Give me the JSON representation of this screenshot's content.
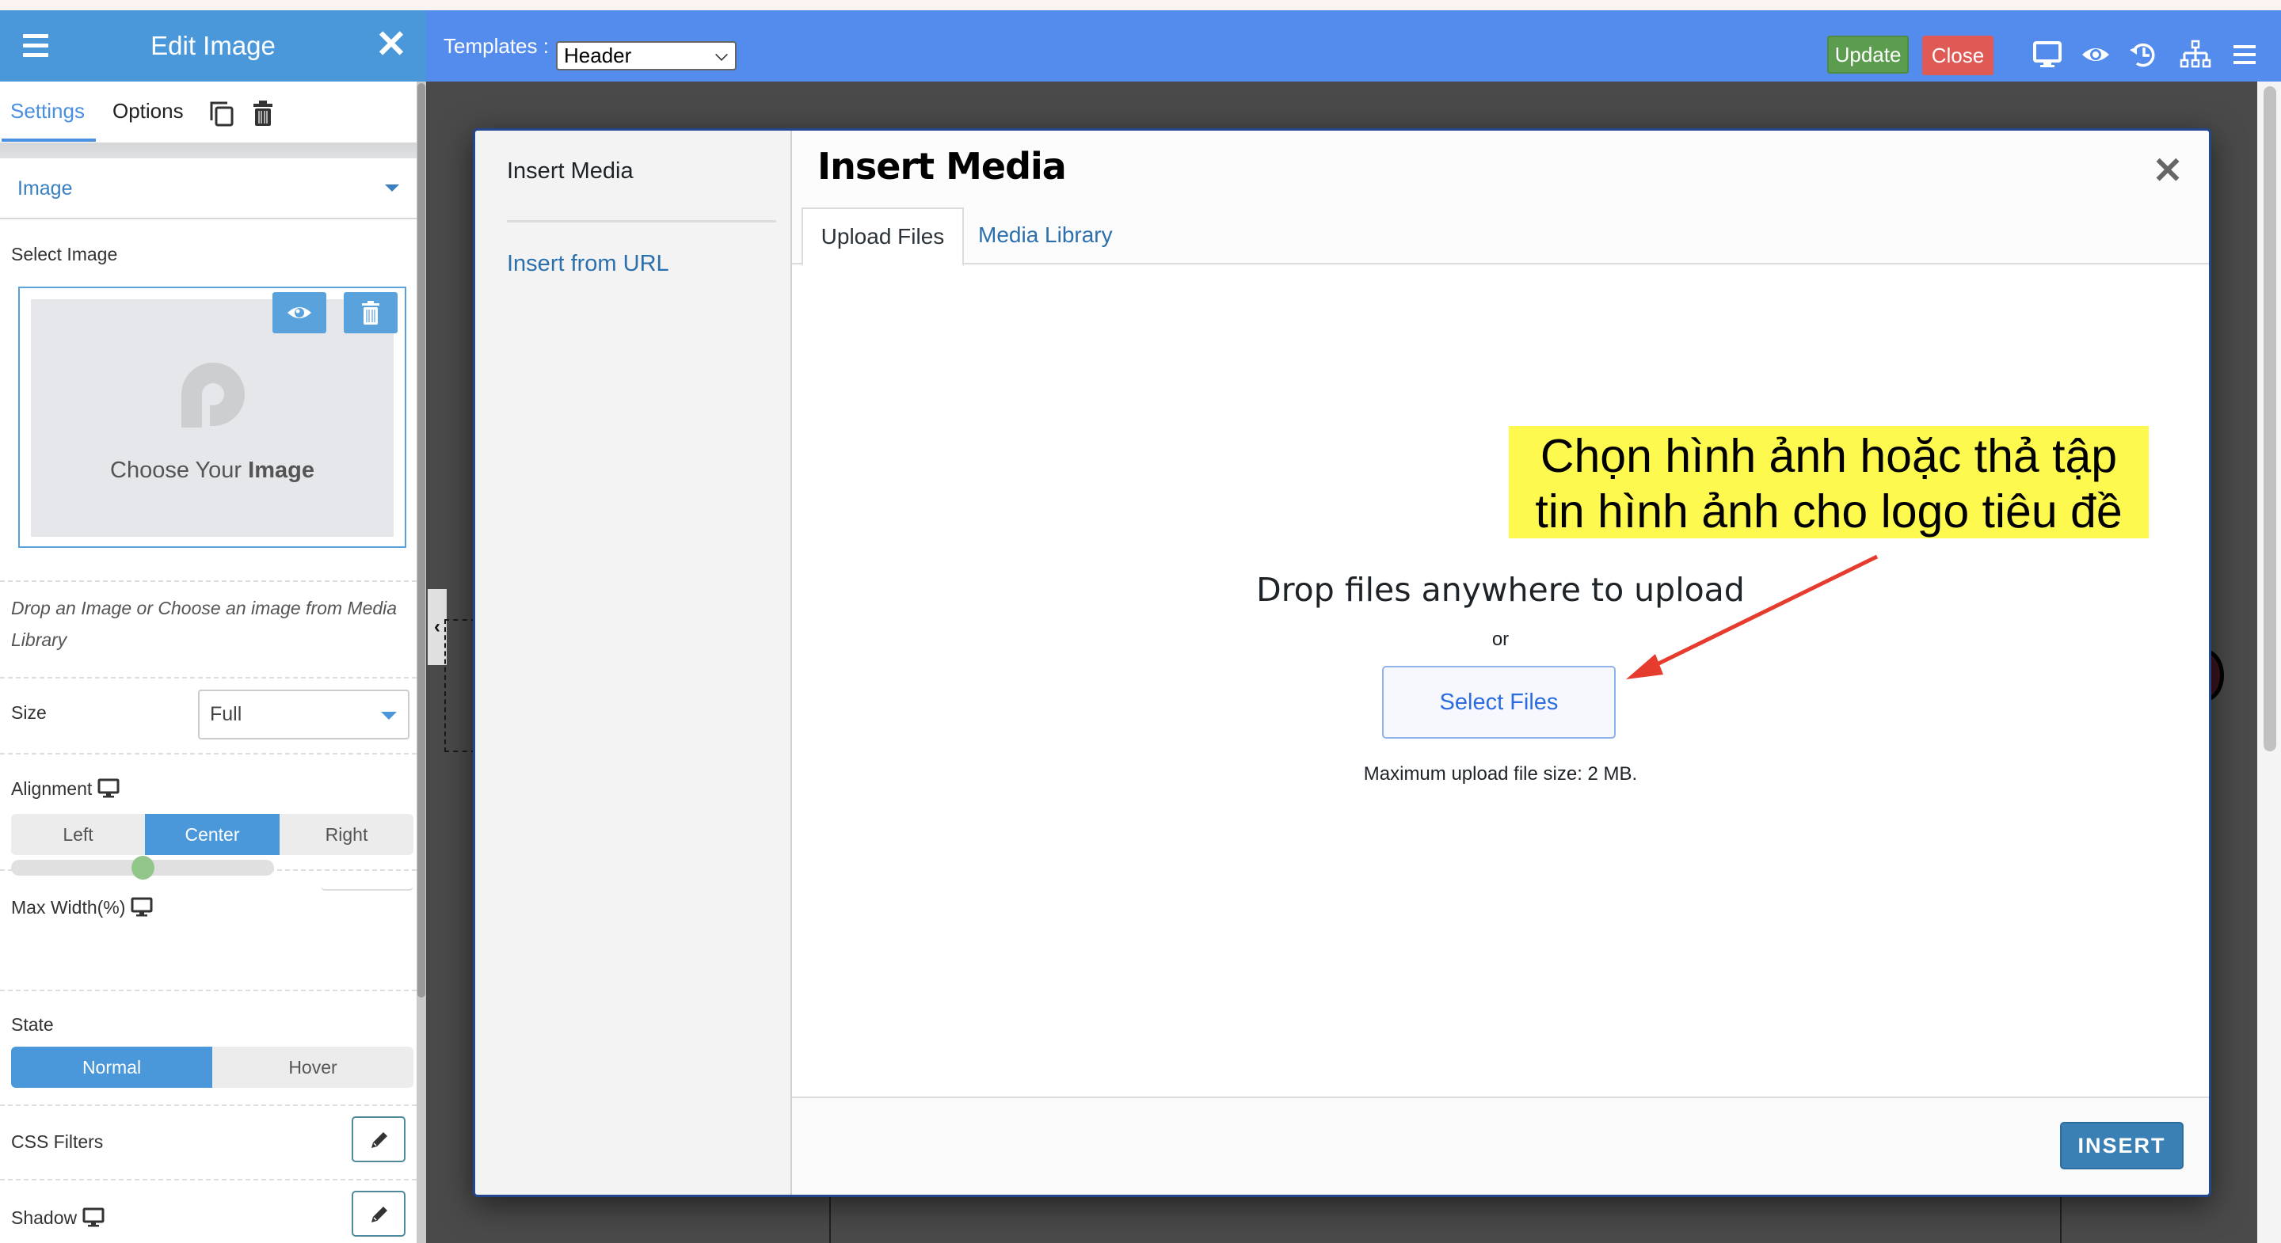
{
  "header": {
    "panel_title": "Edit Image",
    "templates_label": "Templates :",
    "templates_value": "Header",
    "update_label": "Update",
    "close_label": "Close",
    "icons": [
      "desktop-icon",
      "preview-eye-icon",
      "history-icon",
      "sitemap-icon",
      "menu-icon"
    ]
  },
  "panel": {
    "tabs": [
      {
        "label": "Settings",
        "active": true
      },
      {
        "label": "Options",
        "active": false
      }
    ],
    "section_title": "Image",
    "select_image_label": "Select Image",
    "choose_text_prefix": "Choose  Your",
    "choose_text_bold": "Image",
    "hint": "Drop an Image or Choose an image from Media Library",
    "size_label": "Size",
    "size_value": "Full",
    "alignment_label": "Alignment",
    "alignment_options": [
      "Left",
      "Center",
      "Right"
    ],
    "alignment_selected": "Center",
    "max_width_label": "Max Width(%)",
    "max_width_slider_fraction": 0.5,
    "max_width_value": "",
    "state_label": "State",
    "state_options": [
      "Normal",
      "Hover"
    ],
    "state_selected": "Normal",
    "css_filters_label": "CSS Filters",
    "shadow_label": "Shadow"
  },
  "modal": {
    "sidebar_title": "Insert Media",
    "sidebar_link": "Insert from URL",
    "title": "Insert Media",
    "tabs": [
      {
        "label": "Upload Files",
        "active": true
      },
      {
        "label": "Media Library",
        "active": false
      }
    ],
    "drop_text": "Drop files anywhere to upload",
    "or_text": "or",
    "select_files_label": "Select Files",
    "max_size_text": "Maximum upload file size: 2 MB.",
    "insert_label": "INSERT"
  },
  "annotation": {
    "line1": "Chọn hình ảnh hoặc thả tập",
    "line2": "tin hình ảnh cho logo tiêu đề",
    "background": "#fdf94f",
    "arrow_color": "#e53c2e"
  },
  "colors": {
    "header_blue": "#548ced",
    "panel_header_blue": "#4a98d9",
    "update_green": "#5c9c4e",
    "close_red": "#e05a55",
    "insert_blue": "#3b80b4"
  }
}
